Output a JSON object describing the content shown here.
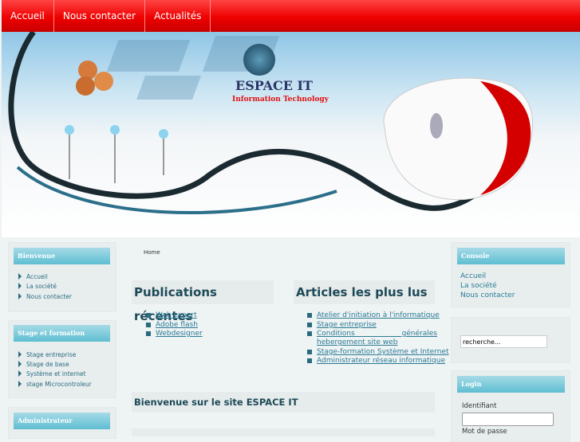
{
  "nav": [
    "Accueil",
    "Nous contacter",
    "Actualités"
  ],
  "banner": {
    "title": "ESPACE IT",
    "subtitle": "Information Technology"
  },
  "left": [
    {
      "title": "Bienvenue",
      "items": [
        "Accueil",
        "La société",
        "Nous contacter"
      ]
    },
    {
      "title": "Stage et formation",
      "items": [
        "Stage entreprise",
        "Stage de base",
        "Système et internet",
        "stage Microcontroleur"
      ]
    },
    {
      "title": "Administrateur",
      "items": []
    }
  ],
  "breadcrumb": "Home",
  "publications": {
    "title": "Publications récentes",
    "items": [
      "Web expert",
      "Adobe flash",
      "Webdesigner"
    ]
  },
  "articles": {
    "title": "Articles les plus lus",
    "items": [
      "Atelier d'initiation à l'informatique",
      "Stage entreprise",
      "Conditions générales hebergement site web",
      "Stage-formation Système et Internet",
      "Administrateur réseau informatique"
    ]
  },
  "welcome": "Bienvenue sur le site ESPACE IT",
  "console": {
    "title": "Console",
    "items": [
      "Accueil",
      "La société",
      "Nous contacter"
    ]
  },
  "search": {
    "value": "recherche..."
  },
  "login": {
    "title": "Login",
    "username_label": "Identifiant",
    "password_label": "Mot de passe"
  }
}
